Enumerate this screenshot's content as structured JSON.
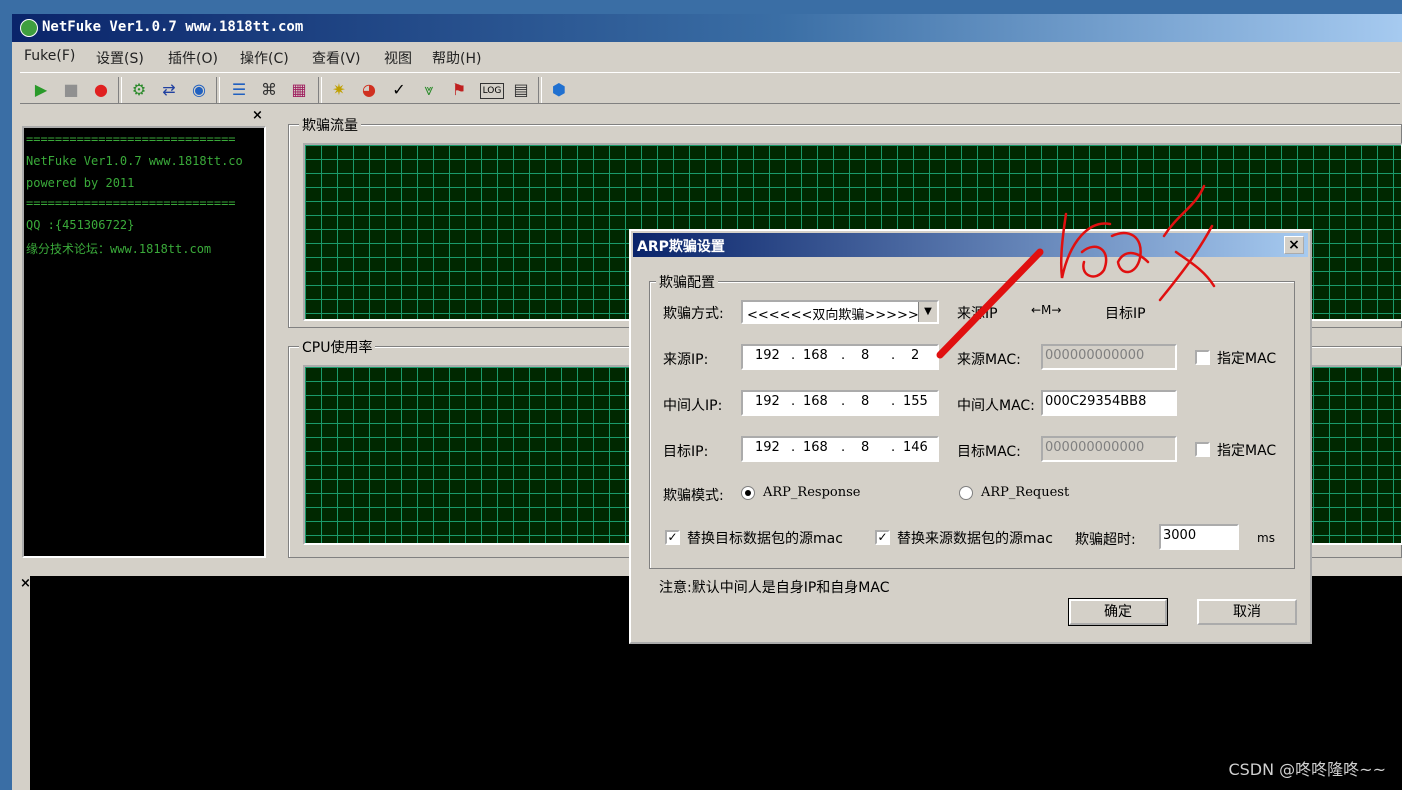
{
  "app": {
    "title": "NetFuke Ver1.0.7 www.1818tt.com",
    "menu": [
      "Fuke(F)",
      "设置(S)",
      "插件(O)",
      "操作(C)",
      "查看(V)",
      "视图",
      "帮助(H)"
    ]
  },
  "toolbar_icons": [
    "play-icon",
    "stop-icon",
    "record-icon",
    "settings-icon",
    "swap-icon",
    "globe-icon",
    "list-icon",
    "plugin-icon",
    "grid-icon",
    "sun-icon",
    "fire-icon",
    "check-icon",
    "filter-icon",
    "flag-icon",
    "log-icon",
    "report-icon",
    "home-icon"
  ],
  "left_panel": {
    "lines": [
      "=============================",
      "NetFuke Ver1.0.7 www.1818tt.co",
      "powered by        2011",
      "=============================",
      "QQ  :{451306722}",
      "缘分技术论坛：www.1818tt.com"
    ]
  },
  "panels": {
    "traffic_label": "欺骗流量",
    "cpu_label": "CPU使用率"
  },
  "dialog": {
    "title": "ARP欺骗设置",
    "group_label": "欺骗配置",
    "method_label": "欺骗方式:",
    "method_value": "<<<<<<双向欺骗>>>>>>",
    "source_ip_header": "来源IP",
    "arrow_label": "←M→",
    "target_ip_header": "目标IP",
    "source_ip_label": "来源IP:",
    "source_ip": [
      "192",
      "168",
      "8",
      "2"
    ],
    "source_mac_label": "来源MAC:",
    "source_mac": "000000000000",
    "mitm_ip_label": "中间人IP:",
    "mitm_ip": [
      "192",
      "168",
      "8",
      "155"
    ],
    "mitm_mac_label": "中间人MAC:",
    "mitm_mac": "000C29354BB8",
    "target_ip_label": "目标IP:",
    "target_ip": [
      "192",
      "168",
      "8",
      "146"
    ],
    "target_mac_label": "目标MAC:",
    "target_mac": "000000000000",
    "specify_mac": "指定MAC",
    "mode_label": "欺骗模式:",
    "mode_response": "ARP_Response",
    "mode_request": "ARP_Request",
    "replace_target": "替换目标数据包的源mac",
    "replace_source": "替换来源数据包的源mac",
    "timeout_label": "欺骗超时:",
    "timeout_value": "3000",
    "timeout_unit": "ms",
    "note": "注意:默认中间人是自身IP和自身MAC",
    "ok": "确定",
    "cancel": "取消"
  },
  "annotation_color": "#e01010",
  "watermark": "CSDN @咚咚隆咚~~"
}
